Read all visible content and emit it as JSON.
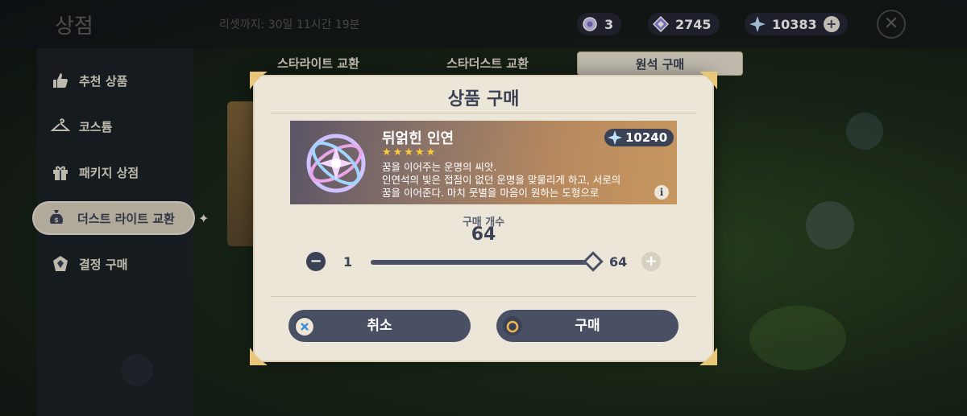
{
  "header": {
    "shop_title": "상점",
    "countdown": "리셋까지: 30일 11시간 19분",
    "currencies": [
      {
        "name": "intertwined-fate-count",
        "value": "3"
      },
      {
        "name": "masterless-starglitter",
        "value": "2745"
      },
      {
        "name": "primogem",
        "value": "10383"
      }
    ]
  },
  "sidebar": {
    "items": [
      {
        "label": "추천 상품",
        "icon": "thumbs-up-icon"
      },
      {
        "label": "코스튬",
        "icon": "hanger-icon"
      },
      {
        "label": "패키지 상점",
        "icon": "gift-icon"
      },
      {
        "label": "더스트 라이트 교환",
        "icon": "money-bag-icon"
      },
      {
        "label": "결정 구매",
        "icon": "crystal-icon"
      }
    ],
    "active_index": 3
  },
  "tabs": [
    {
      "label": "스타라이트 교환"
    },
    {
      "label": "스타더스트 교환"
    },
    {
      "label": "원석 구매"
    }
  ],
  "modal": {
    "title": "상품 구매",
    "item": {
      "name": "뒤얽힌 인연",
      "rarity": 5,
      "price": "10240",
      "description_lines": [
        "꿈을 이어주는 운명의 씨앗.",
        "인연석의 빛은 접점이 없던 운명을 맞물리게 하고, 서로의",
        "꿈을 이어준다. 마치 뭇별을 마음이 원하는 도형으로"
      ]
    },
    "quantity_label": "구매 개수",
    "quantity": "64",
    "slider": {
      "min": "1",
      "max": "64",
      "value_fraction": 1.0
    },
    "cancel_label": "취소",
    "buy_label": "구매"
  },
  "colors": {
    "accent_dark": "#3b4255",
    "button_bg": "#4a5064",
    "panel_bg": "#ece6d8",
    "star": "#ffcc33"
  }
}
